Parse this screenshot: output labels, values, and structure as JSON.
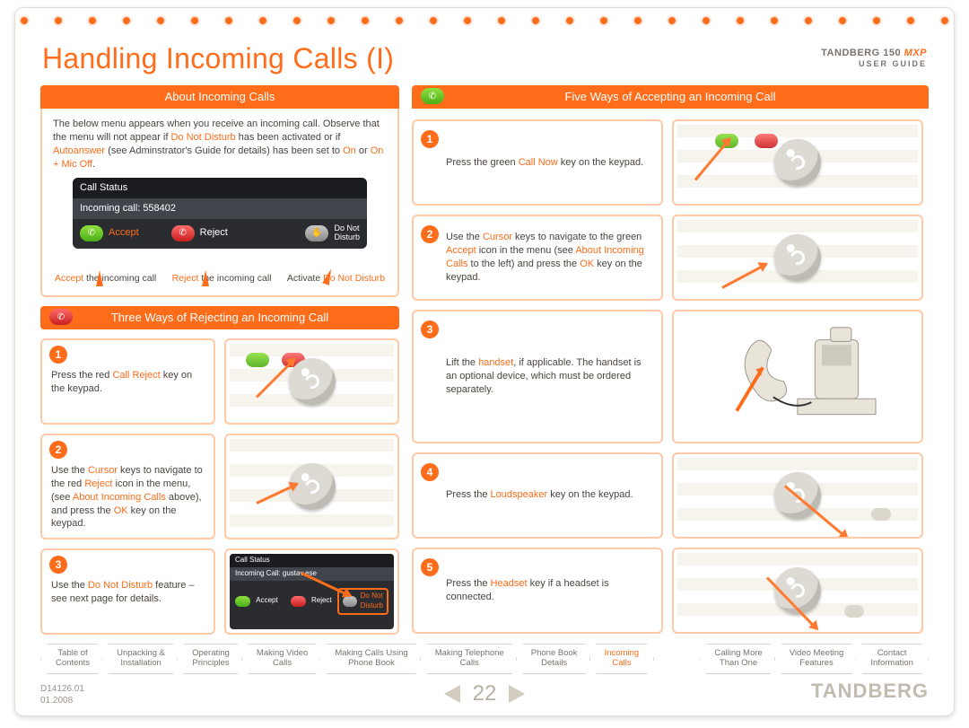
{
  "title": "Handling Incoming Calls (I)",
  "brand": {
    "name": "TANDBERG 150",
    "mxp": " MXP",
    "sub": "USER GUIDE"
  },
  "about": {
    "header": "About Incoming Calls",
    "intro_1": "The below menu appears when you receive an incoming call. Observe that the menu will not appear if ",
    "intro_dnd": "Do Not Disturb",
    "intro_2": " has been activated or if ",
    "intro_auto": "Autoanswer",
    "intro_3": " (see Adminstrator's Guide for details) has been set to ",
    "intro_on": "On",
    "intro_4": " or ",
    "intro_onmic": "On + Mic Off",
    "intro_5": ".",
    "menu": {
      "row1": "Call Status",
      "row2": "Incoming call: 558402",
      "accept": "Accept",
      "reject": "Reject",
      "dnd1": "Do Not",
      "dnd2": "Disturb"
    },
    "cap1a": "Accept",
    "cap1b": " the incoming call",
    "cap2a": "Reject",
    "cap2b": " the incoming call",
    "cap3a": "Activate ",
    "cap3b": "Do Not Disturb"
  },
  "reject_header": "Three Ways of Rejecting an Incoming Call",
  "reject": {
    "s1a": "Press the red ",
    "s1b": "Call Reject",
    "s1c": " key on the keypad.",
    "s2a": "Use the ",
    "s2b": "Cursor",
    "s2c": " keys to navigate to the red ",
    "s2d": "Reject",
    "s2e": " icon  in the menu, (see ",
    "s2f": "About Incoming Calls",
    "s2g": " above), and press the ",
    "s2h": "OK",
    "s2i": " key on the keypad.",
    "s3a": "Use the ",
    "s3b": "Do Not Disturb",
    "s3c": " feature – see next page for details.",
    "mini": {
      "r1": "Call Status",
      "r2": "Incoming Call: gustav.ese",
      "acc": "Accept",
      "rej": "Reject",
      "dn1": "Do Not",
      "dn2": "Disturb"
    }
  },
  "accept_header": "Five Ways of Accepting an Incoming Call",
  "accept": {
    "s1a": "Press the green ",
    "s1b": "Call Now",
    "s1c": " key on the keypad.",
    "s2a": "Use the ",
    "s2b": "Cursor",
    "s2c": " keys to navigate to the green ",
    "s2d": "Accept",
    "s2e": " icon in the menu (see ",
    "s2f": "About Incoming Calls",
    "s2g": " to the left) and press the ",
    "s2h": "OK",
    "s2i": " key on the keypad.",
    "s3a": "Lift the ",
    "s3b": "handset",
    "s3c": ", if applicable. The handset is an optional device, which must be ordered separately.",
    "s4a": "Press the ",
    "s4b": "Loudspeaker",
    "s4c": " key on the keypad.",
    "s5a": "Press the ",
    "s5b": "Headset",
    "s5c": " key if a headset is connected."
  },
  "nav": [
    "Table of Contents",
    "Unpacking & Installation",
    "Operating Principles",
    "Making Video Calls",
    "Making Calls Using Phone Book",
    "Making Telephone Calls",
    "Phone Book Details",
    "Incoming Calls",
    "Calling More Than One",
    "Video Meeting Features",
    "Contact Information"
  ],
  "nav_active_index": 7,
  "footer": {
    "doc": "D14126.01",
    "date": "01.2008",
    "page": "22",
    "logo": "TANDBERG"
  }
}
